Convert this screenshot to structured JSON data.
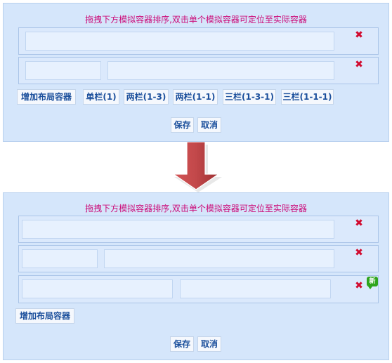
{
  "before": {
    "hint": "拖拽下方模拟容器排序,双击单个模拟容器可定位至实际容器",
    "rows": [
      {
        "delete_label": "✖"
      },
      {
        "delete_label": "✖"
      }
    ],
    "toolbar": {
      "add_label": "增加布局容器",
      "layouts": [
        "单栏(1)",
        "两栏(1-3)",
        "两栏(1-1)",
        "三栏(1-3-1)",
        "三栏(1-1-1)"
      ]
    },
    "save_label": "保存",
    "cancel_label": "取消"
  },
  "after": {
    "hint": "拖拽下方模拟容器排序,双击单个模拟容器可定位至实际容器",
    "rows": [
      {
        "delete_label": "✖"
      },
      {
        "delete_label": "✖"
      },
      {
        "delete_label": "✖",
        "badge": "新"
      }
    ],
    "toolbar": {
      "add_label": "增加布局容器"
    },
    "save_label": "保存",
    "cancel_label": "取消"
  },
  "colors": {
    "panel_bg": "#d5e6fb",
    "hint": "#cc0d7a",
    "delete": "#d10a2e",
    "button_text": "#1b4f9c",
    "arrow": "#c2484a",
    "new_badge": "#2ea41c"
  },
  "icons": {
    "delete": "close-x-icon",
    "new": "new-badge-icon",
    "flow": "down-arrow-icon"
  }
}
